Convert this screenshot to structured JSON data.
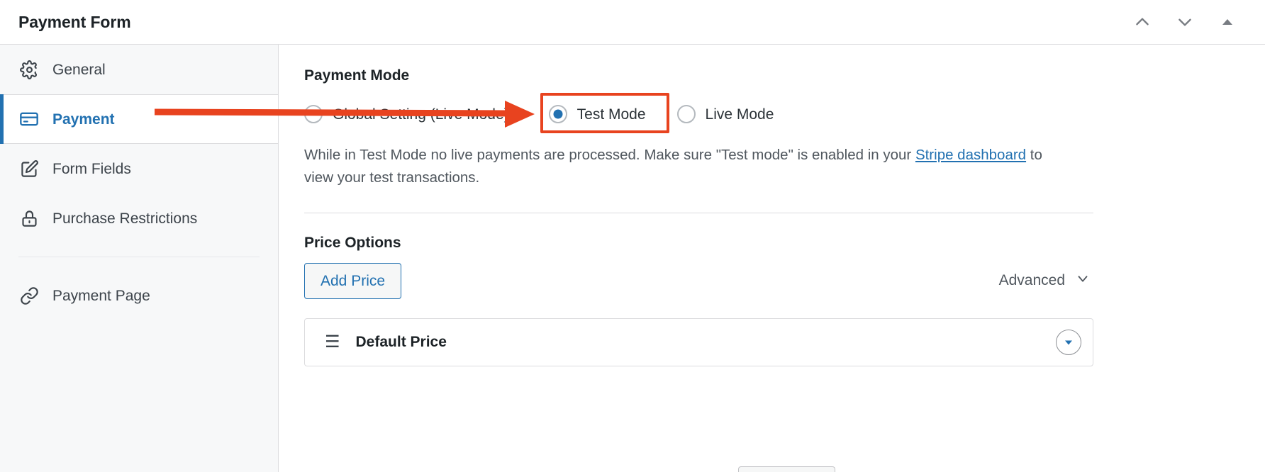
{
  "header": {
    "title": "Payment Form",
    "controls": [
      {
        "name": "move-up-button",
        "icon": "chevron-up-icon"
      },
      {
        "name": "move-down-button",
        "icon": "chevron-down-icon"
      },
      {
        "name": "collapse-panel-button",
        "icon": "triangle-up-icon"
      }
    ]
  },
  "sidebar": {
    "items": [
      {
        "label": "General",
        "icon": "gear-icon",
        "active": false
      },
      {
        "label": "Payment",
        "icon": "credit-card-icon",
        "active": true
      },
      {
        "label": "Form Fields",
        "icon": "edit-square-icon",
        "active": false
      },
      {
        "label": "Purchase Restrictions",
        "icon": "lock-icon",
        "active": false
      },
      {
        "label": "Payment Page",
        "icon": "link-icon",
        "active": false
      }
    ]
  },
  "main": {
    "payment_mode": {
      "title": "Payment Mode",
      "options": [
        {
          "label": "Global Setting (Live Mode)",
          "checked": false
        },
        {
          "label": "Test Mode",
          "checked": true
        },
        {
          "label": "Live Mode",
          "checked": false
        }
      ],
      "description_part1": "While in Test Mode no live payments are processed. Make sure \"Test mode\" is enabled in your ",
      "description_link": "Stripe dashboard",
      "description_part2": " to view your test transactions."
    },
    "price_options": {
      "title": "Price Options",
      "add_price_label": "Add Price",
      "advanced_label": "Advanced",
      "advanced_icon": "chevron-down-icon",
      "rows": [
        {
          "name": "Default Price",
          "drag_icon": "drag-handle-icon",
          "toggle_icon": "chevron-down-circle-icon"
        }
      ]
    }
  },
  "annotations": {
    "arrow_color": "#e8431f",
    "box_color": "#e8431f",
    "target": "Test Mode"
  }
}
